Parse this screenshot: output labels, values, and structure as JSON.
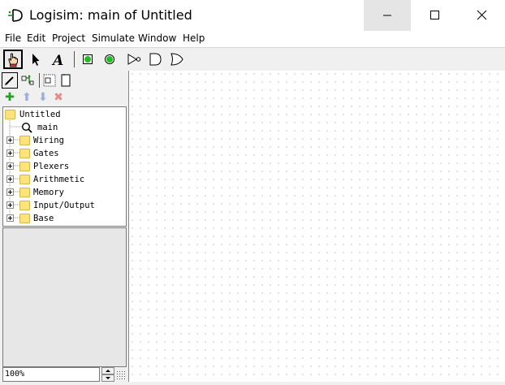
{
  "window": {
    "title": "Logisim: main of Untitled"
  },
  "menu": [
    "File",
    "Edit",
    "Project",
    "Simulate",
    "Window",
    "Help"
  ],
  "toolbar": {
    "tools": [
      "poke-hand-icon",
      "select-arrow-icon",
      "text-tool-icon",
      "input-pin-icon",
      "output-pin-icon",
      "not-gate-icon",
      "and-gate-icon",
      "or-gate-icon"
    ],
    "selected": "poke-hand-icon"
  },
  "explorer": {
    "root": "Untitled",
    "circuit": "main",
    "libraries": [
      "Wiring",
      "Gates",
      "Plexers",
      "Arithmetic",
      "Memory",
      "Input/Output",
      "Base"
    ]
  },
  "zoom": {
    "value": "100%"
  }
}
